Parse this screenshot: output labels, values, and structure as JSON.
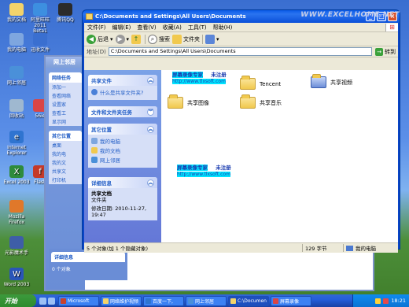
{
  "desktop": {
    "icons": [
      {
        "label": "我的文档",
        "color": "#f2d36b"
      },
      {
        "label": "阿里旺旺 2011 Beta1",
        "color": "#3d8fe0"
      },
      {
        "label": "腾讯QQ",
        "color": "#2b2b2b"
      },
      {
        "label": "我的电脑",
        "color": "#7ea6df"
      },
      {
        "label": "迅收文件",
        "color": "#3a6fd0"
      },
      {
        "label": "网上邻居",
        "color": "#4a90d9"
      },
      {
        "label": "回收站",
        "color": "#9fb8d0"
      },
      {
        "label": "56ie",
        "color": "#d94545"
      },
      {
        "label": "Internet Explorer",
        "color": "#2f74d0"
      },
      {
        "label": "Excel 2003",
        "color": "#2e8b3c"
      },
      {
        "label": "Flash",
        "color": "#c43a2a"
      },
      {
        "label": "Mozilla Firefox",
        "color": "#e0782a"
      },
      {
        "label": "光影魔术手",
        "color": "#3e5ea8"
      },
      {
        "label": "Word 2003",
        "color": "#2a55b8"
      }
    ]
  },
  "background_window": {
    "title": "网上邻居",
    "panels": [
      {
        "title": "网络任务",
        "rows": [
          "添加一",
          "查看网络",
          "设置家",
          "查看工",
          "显示网"
        ]
      },
      {
        "title": "其它位置",
        "rows": [
          "桌面",
          "我的电",
          "我的文",
          "共享文",
          "打印机"
        ]
      }
    ],
    "detail_title": "详细信息"
  },
  "window": {
    "title": "C:\\Documents and Settings\\All Users\\Documents",
    "menu": [
      "文件(F)",
      "编辑(E)",
      "查看(V)",
      "收藏(A)",
      "工具(T)",
      "帮助(H)"
    ],
    "toolbar": {
      "back": "后退",
      "search": "搜索",
      "folders": "文件夹"
    },
    "address_label": "地址(D)",
    "address_value": "C:\\Documents and Settings\\All Users\\Documents",
    "go_label": "转到",
    "task_pane": {
      "shared_title": "共享文件",
      "shared_link": "什么是共享文件夹?",
      "file_tasks_title": "文件和文件夹任务",
      "other_places_title": "其它位置",
      "other_places": [
        "我的电脑",
        "我的文档",
        "网上邻居"
      ],
      "details_title": "详细信息",
      "details_name": "共享文档",
      "details_type": "文件夹",
      "details_modified": "修改日期: 2010-11-27, 19:47"
    },
    "files": [
      {
        "name": "Tencent",
        "type": "folder"
      },
      {
        "name": "共享视频",
        "type": "video"
      },
      {
        "name": "共享图像",
        "type": "image"
      },
      {
        "name": "共享音乐",
        "type": "music"
      }
    ],
    "watermark": {
      "title": "屏幕录像专家",
      "title_extra": "未注册",
      "url": "http://www.tlxsoft.com"
    },
    "status": {
      "objects": "5 个对象(加 1 个隐藏对象)",
      "size": "129 字节",
      "location": "我的电脑"
    }
  },
  "brand_watermark": "WWW.EXCELHOME.NET",
  "taskbar": {
    "start": "开始",
    "tasks": [
      {
        "label": "Microsoft",
        "color": "#c9412e"
      },
      {
        "label": "网络维护视频",
        "color": "#f2d36b"
      },
      {
        "label": "百度一下,",
        "color": "#2f74d0"
      },
      {
        "label": "网上邻居",
        "color": "#4a90d9"
      },
      {
        "label": "C:\\Documen",
        "color": "#f2d36b"
      },
      {
        "label": "屏幕录像",
        "color": "#d94545"
      }
    ],
    "clock": "18:21"
  },
  "bg_status": "0 个对象"
}
